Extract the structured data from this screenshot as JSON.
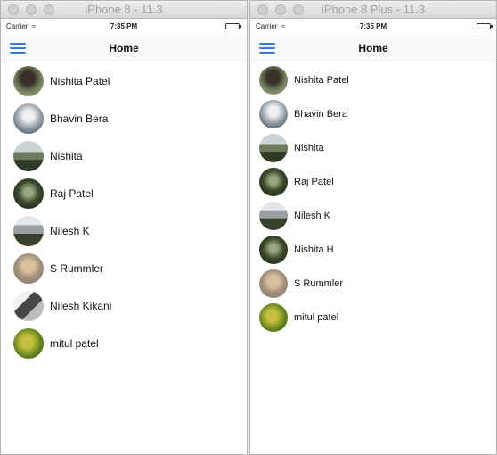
{
  "left": {
    "window_title": "iPhone 8 - 11.3",
    "status": {
      "carrier": "Carrier",
      "wifi_icon": "wifi-icon",
      "time": "7:35 PM"
    },
    "nav": {
      "title": "Home",
      "menu_icon": "hamburger-menu-icon"
    },
    "contacts": [
      {
        "name": "Nishita Patel",
        "avatar": "portrait"
      },
      {
        "name": "Bhavin Bera",
        "avatar": "water"
      },
      {
        "name": "Nishita",
        "avatar": "landscape"
      },
      {
        "name": "Raj Patel",
        "avatar": "dark"
      },
      {
        "name": "Nilesh K",
        "avatar": "stone"
      },
      {
        "name": "S Rummler",
        "avatar": "face"
      },
      {
        "name": "Nilesh Kikani",
        "avatar": "hand"
      },
      {
        "name": "mitul patel",
        "avatar": "leaves"
      }
    ]
  },
  "right": {
    "window_title": "iPhone 8 Plus - 11.3",
    "status": {
      "carrier": "Carrier",
      "wifi_icon": "wifi-icon",
      "time": "7:35 PM"
    },
    "nav": {
      "title": "Home",
      "menu_icon": "hamburger-menu-icon"
    },
    "contacts": [
      {
        "name": "Nishita Patel",
        "avatar": "portrait"
      },
      {
        "name": "Bhavin Bera",
        "avatar": "water"
      },
      {
        "name": "Nishita",
        "avatar": "landscape"
      },
      {
        "name": "Raj Patel",
        "avatar": "dark"
      },
      {
        "name": "Nilesh K",
        "avatar": "stone"
      },
      {
        "name": "Nishita H",
        "avatar": "dark"
      },
      {
        "name": "S Rummler",
        "avatar": "face"
      },
      {
        "name": "mitul patel",
        "avatar": "leaves"
      }
    ]
  },
  "colors": {
    "accent": "#2f7ce0",
    "separator": "#d3d3d3",
    "background": "#ffffff",
    "titlebar": "#dcdcdc"
  }
}
